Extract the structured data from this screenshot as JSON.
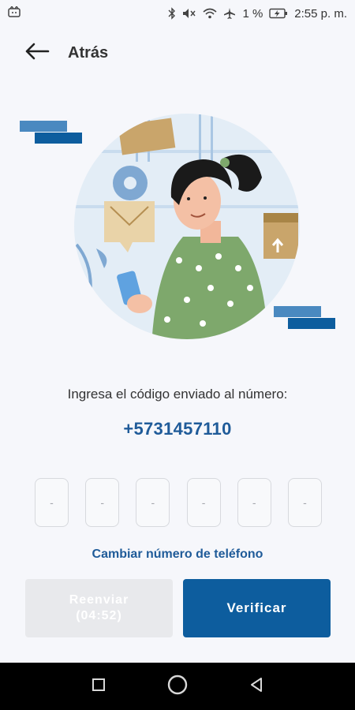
{
  "status_bar": {
    "battery": "1 %",
    "time": "2:55 p. m."
  },
  "header": {
    "back_label": "Atrás"
  },
  "verification": {
    "prompt": "Ingresa el código enviado al número:",
    "phone_number": "+5731457110",
    "code_placeholders": [
      "-",
      "-",
      "-",
      "-",
      "-",
      "-"
    ],
    "change_number_link": "Cambiar número de teléfono"
  },
  "buttons": {
    "resend_label": "Reenviar",
    "resend_timer": "(04:52)",
    "verify_label": "Verificar"
  },
  "colors": {
    "primary": "#0d5d9e",
    "link": "#1f5b99",
    "disabled": "#e8e9ec",
    "background": "#f6f7fb"
  }
}
